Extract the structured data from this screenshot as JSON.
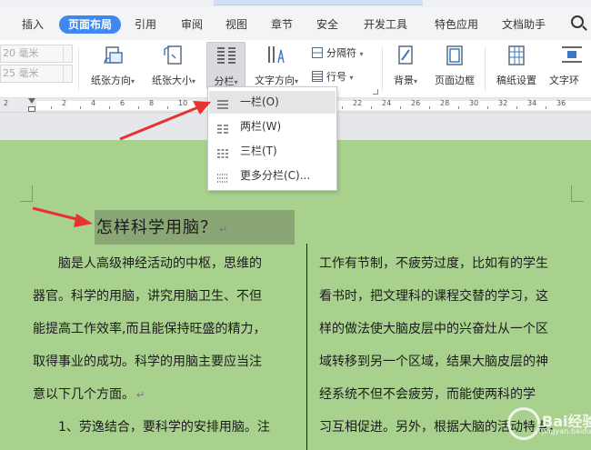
{
  "tabs": [
    {
      "label": "插入",
      "active": false
    },
    {
      "label": "页面布局",
      "active": true
    },
    {
      "label": "引用",
      "active": false
    },
    {
      "label": "审阅",
      "active": false
    },
    {
      "label": "视图",
      "active": false
    },
    {
      "label": "章节",
      "active": false
    },
    {
      "label": "安全",
      "active": false
    },
    {
      "label": "开发工具",
      "active": false
    },
    {
      "label": "特色应用",
      "active": false
    },
    {
      "label": "文档助手",
      "active": false
    },
    {
      "label": "Q",
      "active": false
    }
  ],
  "ribbon": {
    "margin_top_value": "20 毫米",
    "margin_bottom_value": "25 毫米",
    "orientation_label": "纸张方向",
    "size_label": "纸张大小",
    "columns_label": "分栏",
    "text_direction_label": "文字方向",
    "separator_label": "分隔符",
    "line_numbers_label": "行号",
    "background_label": "背景",
    "page_border_label": "页面边框",
    "manuscript_label": "稿纸设置",
    "text_wrap_label": "文字环"
  },
  "columns_menu": {
    "items": [
      {
        "label": "一栏(O)",
        "icon": "one-column-icon",
        "highlighted": true
      },
      {
        "label": "两栏(W)",
        "icon": "two-column-icon",
        "highlighted": false
      },
      {
        "label": "三栏(T)",
        "icon": "three-column-icon",
        "highlighted": false
      },
      {
        "label": "更多分栏(C)...",
        "icon": "more-columns-icon",
        "highlighted": false
      }
    ]
  },
  "ruler": {
    "left_number": "2",
    "numbers": [
      "2",
      "4",
      "6",
      "8",
      "10",
      "12",
      "14",
      "16",
      "18",
      "20",
      "22",
      "24",
      "26",
      "28",
      "30",
      "32",
      "34",
      "36",
      "38"
    ]
  },
  "document": {
    "title": "怎样科学用脑？",
    "left_column": [
      "脑是人高级神经活动的中枢，思维的",
      "器官。科学的用脑，讲究用脑卫生、不但",
      "能提高工作效率,而且能保持旺盛的精力，",
      "取得事业的成功。科学的用脑主要应当注",
      "意以下几个方面。",
      "1、劳逸结合，要科学的安排用脑。注"
    ],
    "right_column": [
      "工作有节制，不疲劳过度，比如有的学生",
      "看书时，把文理科的课程交替的学习，这",
      "样的做法使大脑皮层中的兴奋灶从一个区",
      "域转移到另一个区域，结果大脑皮层的神",
      "经系统不但不会疲劳，而能使两科的学",
      "习互相促进。另外，根据大脑的活动特点，"
    ]
  },
  "watermark": {
    "title": "Bai经验",
    "subtitle": "jingyan.baidu.com"
  },
  "colors": {
    "accent": "#3f88f0",
    "document_bg": "#a9d18e",
    "arrow": "#e8322f"
  }
}
